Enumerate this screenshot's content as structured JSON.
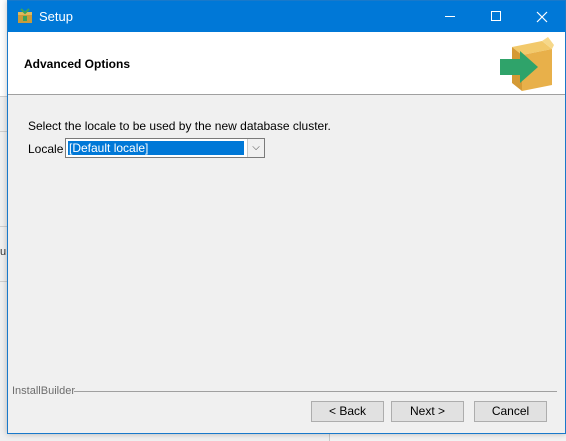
{
  "window": {
    "title": "Setup",
    "icon": "setup-package-icon",
    "controls": [
      "minimize-icon",
      "maximize-icon",
      "close-icon"
    ],
    "accent": "#0078d7"
  },
  "header": {
    "title": "Advanced Options",
    "icon": "box-arrow-icon"
  },
  "content": {
    "description": "Select the locale to be used by the new database cluster.",
    "locale_label": "Locale",
    "locale_value": "[Default locale]"
  },
  "footer": {
    "brand": "InstallBuilder",
    "back_label": "< Back",
    "next_label": "Next >",
    "cancel_label": "Cancel"
  },
  "background": {
    "fragment_text": "u"
  }
}
